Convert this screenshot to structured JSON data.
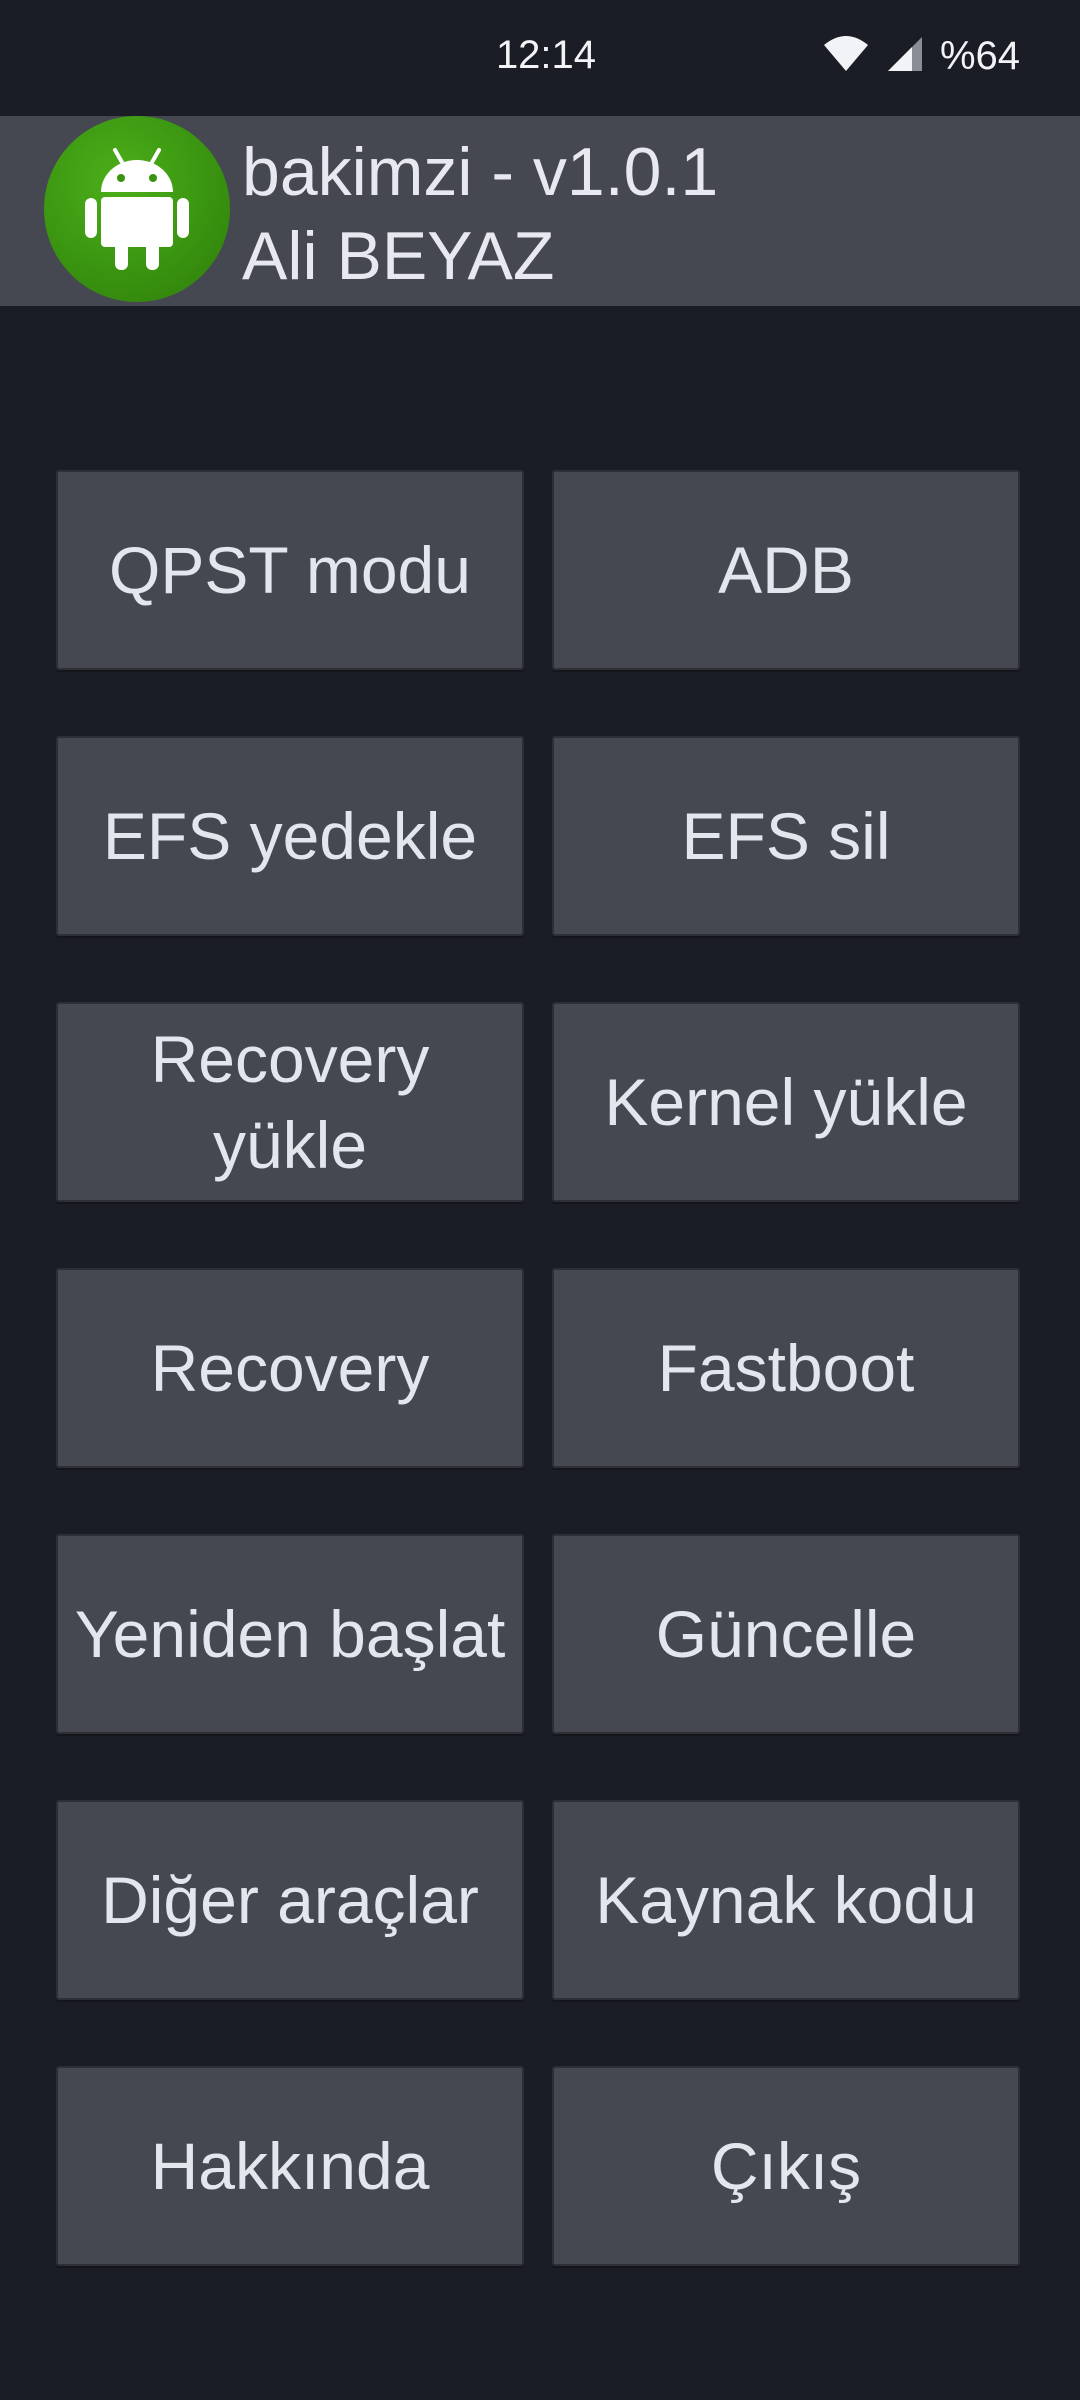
{
  "status_bar": {
    "time": "12:14",
    "battery": "%64",
    "icons": [
      "wifi-icon",
      "cellular-signal-icon"
    ]
  },
  "header": {
    "logo_icon": "android-robot-icon",
    "logo_color": "#3a9410",
    "title": "bakimzi - v1.0.1",
    "author": "Ali BEYAZ"
  },
  "buttons": [
    {
      "id": "qpst-mode",
      "label": "QPST modu"
    },
    {
      "id": "adb",
      "label": "ADB"
    },
    {
      "id": "efs-backup",
      "label": "EFS yedekle"
    },
    {
      "id": "efs-delete",
      "label": "EFS sil"
    },
    {
      "id": "recovery-install",
      "label": "Recovery yükle"
    },
    {
      "id": "kernel-install",
      "label": "Kernel yükle"
    },
    {
      "id": "recovery",
      "label": "Recovery"
    },
    {
      "id": "fastboot",
      "label": "Fastboot"
    },
    {
      "id": "reboot",
      "label": "Yeniden başlat"
    },
    {
      "id": "update",
      "label": "Güncelle"
    },
    {
      "id": "other-tools",
      "label": "Diğer araçlar"
    },
    {
      "id": "source-code",
      "label": "Kaynak kodu"
    },
    {
      "id": "about",
      "label": "Hakkında"
    },
    {
      "id": "exit",
      "label": "Çıkış"
    }
  ],
  "colors": {
    "background": "#1a1d25",
    "button": "#454850",
    "text": "#e4e6ee"
  }
}
